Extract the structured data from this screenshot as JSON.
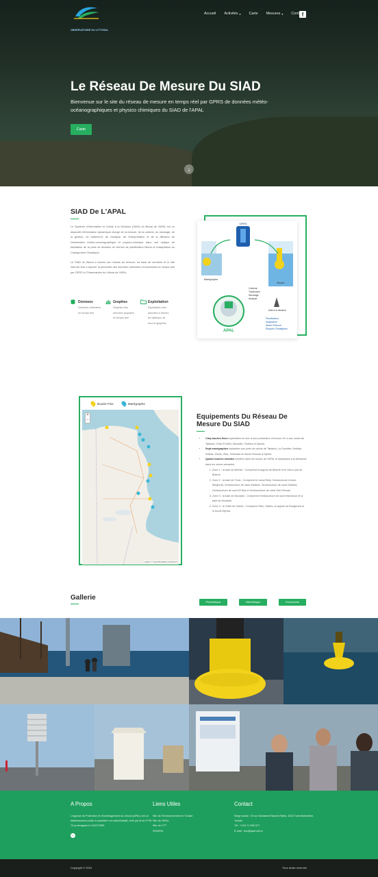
{
  "header": {
    "logo_tagline": "OBSERVATOIRE DU LITTORAL",
    "nav": [
      {
        "label": "Accueil",
        "dropdown": false
      },
      {
        "label": "Activités",
        "dropdown": true
      },
      {
        "label": "Carte",
        "dropdown": false
      },
      {
        "label": "Mesures",
        "dropdown": true
      },
      {
        "label": "Contact",
        "dropdown": false
      }
    ],
    "social_icon": "facebook-icon"
  },
  "hero": {
    "title": "Le Réseau De Mesure Du SIAD",
    "subtitle": "Bienvenue sur le site du réseau de mesure en temps réel par GPRS de données météo-océanographiques et physico chimiques du SIAD de l'APAL",
    "cta_label": "Carte",
    "scroll_icon": "arrow-down-icon"
  },
  "siad": {
    "title": "SIAD De L'APAL",
    "paragraph1": "Le Système d'Information et d'Aide à la Décision (SIAD) du littoral de l'APAL est un dispositif d'information dynamique chargé de la mesure, de la collecte, du stockage, de la gestion, du traitement, de l'analyse, de l'interprétation et de la diffusion de l'information météo-océanographique et physico-chimique dans une optique de facilitation de la prise de décision en termes de planification littoral et d'adaptation au Changement Climatique.",
    "paragraph2": "Le SIAD du littoral a travers son réseau de mesure, sa base de données et le site internet vise à assurer la pérennité des données collectées et transmises en temps réel par GPRS à l'Observatoire du Littoral de l'APAL.",
    "features": [
      {
        "title": "Donnees",
        "icon": "database-icon",
        "desc": "Données collectées en temps réel"
      },
      {
        "title": "Graphes",
        "icon": "bar-chart-icon",
        "desc": "Graphes des données acquises en temps réel"
      },
      {
        "title": "Exploitation",
        "icon": "folder-icon",
        "desc": "Exploitation des données à travers les tableaux de bord et graphes"
      }
    ],
    "diagram": {
      "gprs": "GPRS",
      "maregraphe": "Marégraphe",
      "bouee": "Bouée",
      "flow": [
        "Collecte",
        "Traitement",
        "Stockage",
        "Analyse"
      ],
      "decision": "Aide à la décision",
      "outcomes": [
        "Planification",
        "Adaptation",
        "Alerte Précoce",
        "Risques Climatiques"
      ],
      "center": "APAL"
    }
  },
  "equipements": {
    "legend": [
      {
        "label": "Bouée Fixe",
        "color": "#f2d21b"
      },
      {
        "label": "Marégraphe",
        "color": "#38b6d6"
      }
    ],
    "map_attribution": "Leaflet | © OpenStreetMap contributors",
    "zoom_in": "+",
    "zoom_out": "−",
    "title": "Equipements Du Réseau De Mesure Du SIAD",
    "items": [
      {
        "strong": "Cinq bouées fixes",
        "text": " implantées en mer à une profondeur d'environ 15 m aux zones de Tabarka, Ghar El Melh, Monastir, Chebba et Djerba"
      },
      {
        "strong": "Sept marégraphes",
        "text": " implantés aux ports de pêche de Tabarka, La Goulette, Mahdia, Kelibia, Zarzis, Sfax, Teboulba et Houmt Essouk à Djerba"
      },
      {
        "strong": "Quatre bouées mobiles",
        "text": " crédées dans les locaux de l'APAL et déployées à la demande dans les zones suivantes"
      }
    ],
    "zones": [
      "Zone 1 : la baie de Bizerte : Comprend la lagune de Bizerte et le Vieux port de Bizerte",
      "Zone 2 : la baie de Tunis : Comprend le canal Rafy, l'embouchure d'oued Medjerda, l'embouchure de oued Meliane, l'embouchure de oued Sebkha, l'embouchure de oued El Bey et l'embouchure de oued Sidi Othman",
      "Zone 3 : la baie de Monastir : Comprend l'embouchure de oued Hamdoun et la baie de Monastir",
      "Zone 4 : le Golfe de Gabès : Comprend Sfax, Gabès, la lagune de Boughrara et le bordé Djerba"
    ]
  },
  "gallery": {
    "title": "Gallerie",
    "filters": [
      "Photothèque",
      "Vidéothèque",
      "Documents"
    ]
  },
  "footer": {
    "about_title": "A Propos",
    "about_text": "L'Agence de Protection et d'Aménagement du Littoral (APAL) est un établissement public à caractère non administratif, créé par la loi N°95-72 promulguée le 24/07/1995.",
    "social_icon": "facebook-icon",
    "links_title": "Liens Utiles",
    "links": [
      "Site de l'Environnement en Tunisie",
      "Site de l'APAL",
      "Site de CTT",
      "SIGAPAL"
    ],
    "contact_title": "Contact",
    "contact_lines": [
      "Siège social : 03 rue Mohamed Rachid Ridha, 1002 Tunis Belvédère-Tunisie",
      "Tél : +216 71 906 577",
      "E-mail : boc@apal.nat.tn"
    ],
    "copyright": "Copyright © 2022",
    "rights": "Tous droits réservés"
  }
}
